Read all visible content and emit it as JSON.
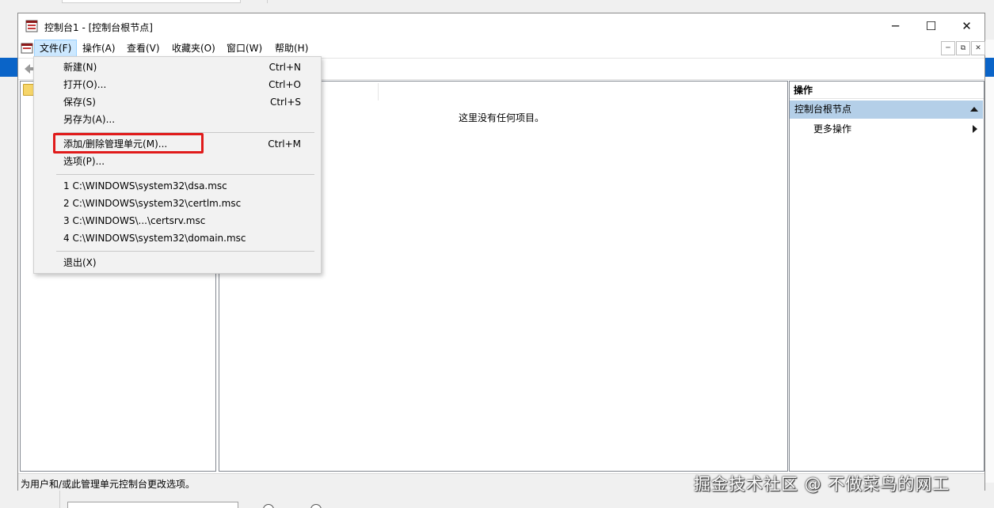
{
  "window": {
    "title": "控制台1 - [控制台根节点]",
    "controls": {
      "minimize": "─",
      "maximize": "☐",
      "close": "✕"
    },
    "icon": "mmc-console-icon"
  },
  "menubar": {
    "items": [
      {
        "label": "文件(F)",
        "active": true
      },
      {
        "label": "操作(A)"
      },
      {
        "label": "查看(V)"
      },
      {
        "label": "收藏夹(O)"
      },
      {
        "label": "窗口(W)"
      },
      {
        "label": "帮助(H)"
      }
    ],
    "mdi_controls": {
      "minimize": "─",
      "restore": "⧉",
      "close": "✕"
    }
  },
  "file_menu": {
    "items": [
      {
        "label": "新建(N)",
        "shortcut": "Ctrl+N"
      },
      {
        "label": "打开(O)...",
        "shortcut": "Ctrl+O"
      },
      {
        "label": "保存(S)",
        "shortcut": "Ctrl+S"
      },
      {
        "label": "另存为(A)..."
      },
      {
        "label": "添加/删除管理单元(M)...",
        "shortcut": "Ctrl+M",
        "highlighted": true
      },
      {
        "label": "选项(P)..."
      },
      {
        "label": "1 C:\\WINDOWS\\system32\\dsa.msc"
      },
      {
        "label": "2 C:\\WINDOWS\\system32\\certlm.msc"
      },
      {
        "label": "3 C:\\WINDOWS\\...\\certsrv.msc"
      },
      {
        "label": "4 C:\\WINDOWS\\system32\\domain.msc"
      },
      {
        "label": "退出(X)"
      }
    ]
  },
  "main": {
    "empty_text": "这里没有任何项目。"
  },
  "actions_pane": {
    "header": "操作",
    "section": "控制台根节点",
    "more": "更多操作"
  },
  "statusbar": {
    "text": "为用户和/或此管理单元控制台更改选项。"
  },
  "watermark": "掘金技术社区 @ 不做菜鸟的网工",
  "colors": {
    "highlight_box": "#e01b1b",
    "section_bg": "#b4cfe8",
    "menu_active": "#cce8ff"
  }
}
